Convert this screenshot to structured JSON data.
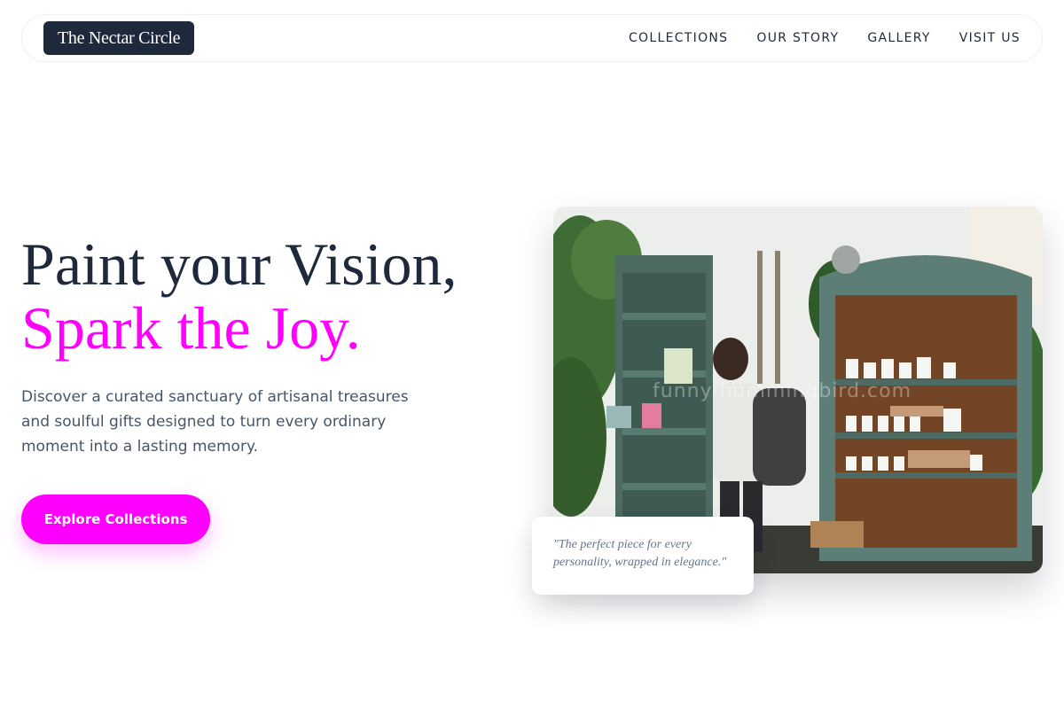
{
  "header": {
    "logo": "The Nectar Circle",
    "nav": [
      "COLLECTIONS",
      "OUR STORY",
      "GALLERY",
      "VISIT US"
    ]
  },
  "hero": {
    "title_line1": "Paint your Vision,",
    "title_line2": "Spark the Joy.",
    "description": "Discover a curated sanctuary of artisanal treasures and soulful gifts designed to turn every ordinary moment into a lasting memory.",
    "cta_label": "Explore Collections"
  },
  "image_card": {
    "watermark": "funny hummingbird.com",
    "quote": "\"The perfect piece for every personality, wrapped in elegance.\""
  },
  "colors": {
    "accent": "#ff00ff",
    "dark": "#1e293b",
    "muted": "#475569"
  }
}
